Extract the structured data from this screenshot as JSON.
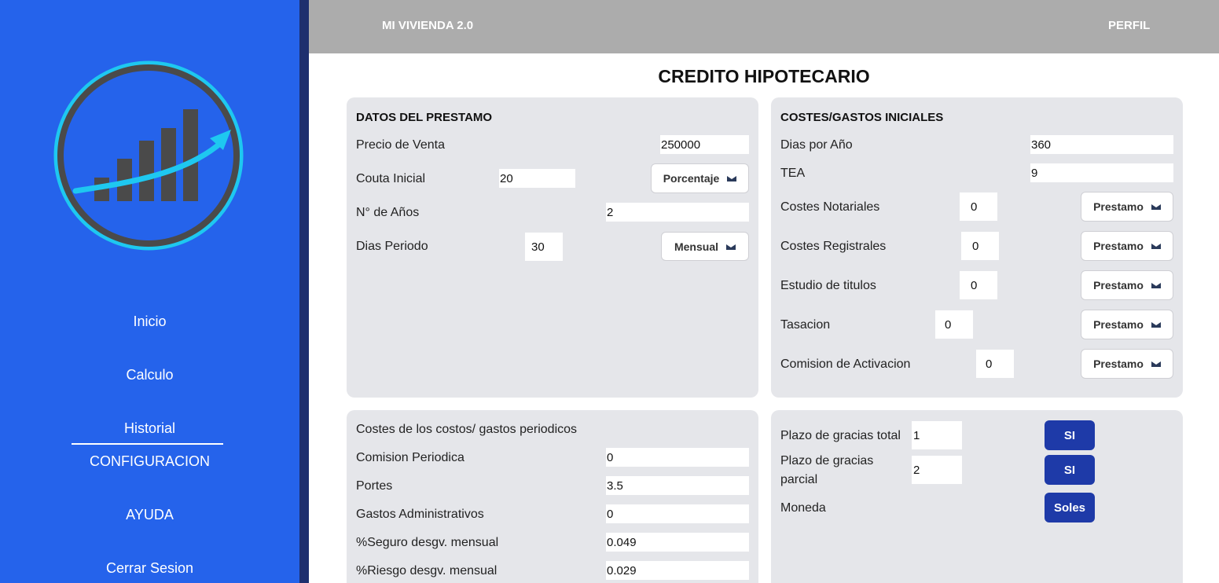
{
  "sidebar": {
    "nav": [
      "Inicio",
      "Calculo",
      "Historial",
      "CONFIGURACION",
      "AYUDA",
      "Cerrar Sesion"
    ]
  },
  "topbar": {
    "brand": "MI VIVIENDA 2.0",
    "profile": "PERFIL"
  },
  "page": {
    "title": "CREDITO HIPOTECARIO"
  },
  "loan": {
    "title": "DATOS DEL PRESTAMO",
    "sale_price_label": "Precio de Venta",
    "sale_price": "250000",
    "down_payment_label": "Couta Inicial",
    "down_payment": "20",
    "down_payment_type": "Porcentaje",
    "years_label": "N° de Años",
    "years": "2",
    "period_days_label": "Dias Periodo",
    "period_days": "30",
    "period_type": "Mensual"
  },
  "initial_costs": {
    "title": "COSTES/GASTOS INICIALES",
    "days_year_label": "Dias por Año",
    "days_year": "360",
    "tea_label": "TEA",
    "tea": "9",
    "items": [
      {
        "label": "Costes Notariales",
        "value": "0",
        "type": "Prestamo"
      },
      {
        "label": "Costes Registrales",
        "value": "0",
        "type": "Prestamo"
      },
      {
        "label": "Estudio de titulos",
        "value": "0",
        "type": "Prestamo"
      },
      {
        "label": "Tasacion",
        "value": "0",
        "type": "Prestamo"
      },
      {
        "label": "Comision de Activacion",
        "value": "0",
        "type": "Prestamo"
      }
    ]
  },
  "periodic_costs": {
    "title": "Costes de los costos/ gastos periodicos",
    "items": [
      {
        "label": "Comision Periodica",
        "value": "0"
      },
      {
        "label": "Portes",
        "value": "3.5"
      },
      {
        "label": "Gastos Administrativos",
        "value": "0"
      },
      {
        "label": "%Seguro desgv. mensual",
        "value": "0.049"
      },
      {
        "label": "%Riesgo desgv. mensual",
        "value": "0.029"
      }
    ]
  },
  "grace": {
    "total_label": "Plazo de gracias total",
    "total_value": "1",
    "total_toggle": "SI",
    "partial_label_1": "Plazo de gracias",
    "partial_label_2": "parcial",
    "partial_value": "2",
    "partial_toggle": "SI",
    "currency_label": "Moneda",
    "currency": "Soles"
  },
  "colors": {
    "sidebar": "#2563eb",
    "sidebar_edge": "#1e2f6e",
    "topbar": "#acacac",
    "panel": "#e5e6ea",
    "button": "#1e3aa8",
    "logo_ring": "#22d3ee",
    "logo_bars": "#4a4a4a"
  }
}
